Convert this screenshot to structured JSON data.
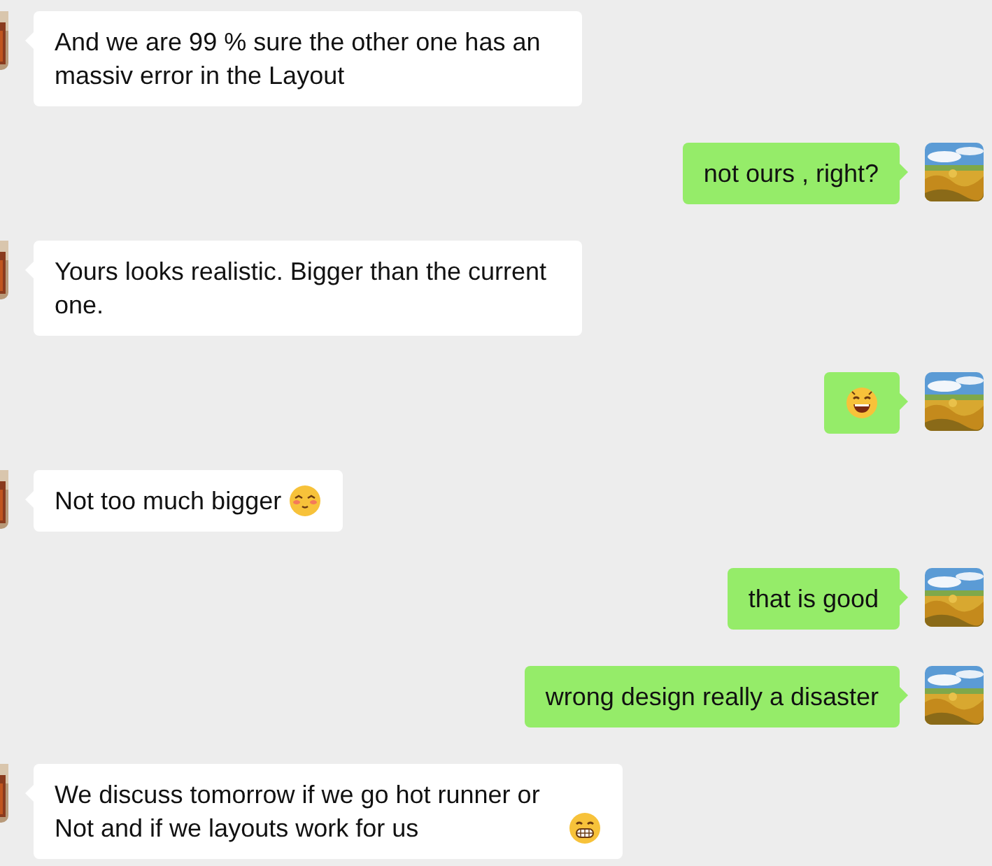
{
  "messages": [
    {
      "outgoing": false,
      "text": "And we are 99 % sure the other one has an massiv error in the Layout"
    },
    {
      "outgoing": true,
      "text": "not ours , right?"
    },
    {
      "outgoing": false,
      "text": "Yours looks realistic. Bigger than the current one."
    },
    {
      "outgoing": true,
      "emoji": {
        "kind": "laugh"
      }
    },
    {
      "outgoing": false,
      "text": "Not too much bigger",
      "emoji": {
        "kind": "shy"
      }
    },
    {
      "outgoing": true,
      "text": "that is good"
    },
    {
      "outgoing": true,
      "text": "wrong design really a disaster"
    },
    {
      "outgoing": false,
      "text": "We discuss tomorrow if we go hot runner or Not and if we layouts work for us",
      "emoji": {
        "kind": "grin"
      }
    }
  ]
}
